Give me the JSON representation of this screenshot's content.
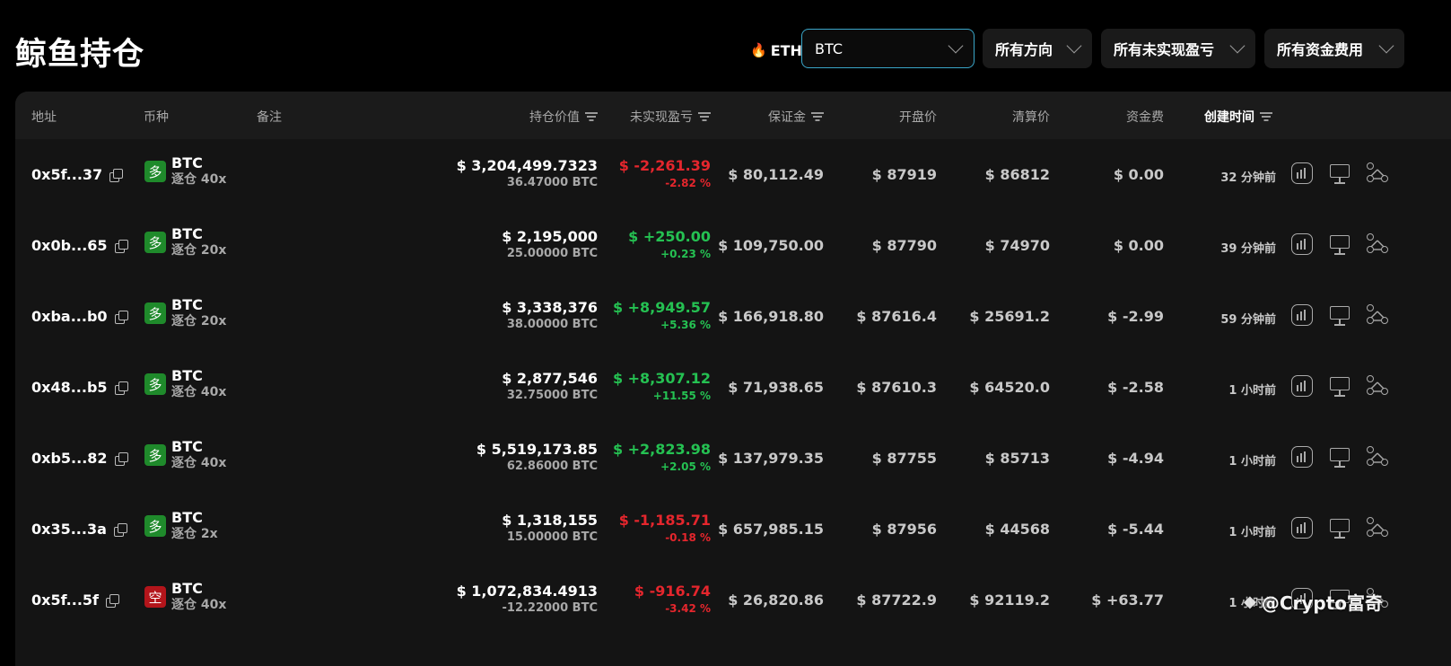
{
  "page": {
    "title": "鲸鱼持仓",
    "hot_coin": "ETH",
    "symbol_select": "BTC",
    "direction_select": "所有方向",
    "pnl_select": "所有未实现盈亏",
    "funding_select": "所有资金费用"
  },
  "table": {
    "headers": {
      "address": "地址",
      "coin": "币种",
      "note": "备注",
      "position_value": "持仓价值",
      "unrealized_pnl": "未实现盈亏",
      "margin": "保证金",
      "open_price": "开盘价",
      "liq_price": "清算价",
      "funding": "资金费",
      "created": "创建时间"
    },
    "rows": [
      {
        "address": "0x5f...37",
        "side": "多",
        "side_type": "long",
        "coin": "BTC",
        "leverage": "逐仓 40x",
        "value": "$ 3,204,499.7323",
        "size": "36.47000 BTC",
        "pnl": "$ -2,261.39",
        "pnl_pct": "-2.82 %",
        "pnl_sign": "neg",
        "margin": "$ 80,112.49",
        "open": "$ 87919",
        "liq": "$ 86812",
        "funding": "$ 0.00",
        "funding_sign": "zero",
        "time": "32 分钟前"
      },
      {
        "address": "0x0b...65",
        "side": "多",
        "side_type": "long",
        "coin": "BTC",
        "leverage": "逐仓 20x",
        "value": "$ 2,195,000",
        "size": "25.00000 BTC",
        "pnl": "$ +250.00",
        "pnl_pct": "+0.23 %",
        "pnl_sign": "pos",
        "margin": "$ 109,750.00",
        "open": "$ 87790",
        "liq": "$ 74970",
        "funding": "$ 0.00",
        "funding_sign": "zero",
        "time": "39 分钟前"
      },
      {
        "address": "0xba...b0",
        "side": "多",
        "side_type": "long",
        "coin": "BTC",
        "leverage": "逐仓 20x",
        "value": "$ 3,338,376",
        "size": "38.00000 BTC",
        "pnl": "$ +8,949.57",
        "pnl_pct": "+5.36 %",
        "pnl_sign": "pos",
        "margin": "$ 166,918.80",
        "open": "$ 87616.4",
        "liq": "$ 25691.2",
        "funding": "$ -2.99",
        "funding_sign": "neg",
        "time": "59 分钟前"
      },
      {
        "address": "0x48...b5",
        "side": "多",
        "side_type": "long",
        "coin": "BTC",
        "leverage": "逐仓 40x",
        "value": "$ 2,877,546",
        "size": "32.75000 BTC",
        "pnl": "$ +8,307.12",
        "pnl_pct": "+11.55 %",
        "pnl_sign": "pos",
        "margin": "$ 71,938.65",
        "open": "$ 87610.3",
        "liq": "$ 64520.0",
        "funding": "$ -2.58",
        "funding_sign": "neg",
        "time": "1 小时前"
      },
      {
        "address": "0xb5...82",
        "side": "多",
        "side_type": "long",
        "coin": "BTC",
        "leverage": "逐仓 40x",
        "value": "$ 5,519,173.85",
        "size": "62.86000 BTC",
        "pnl": "$ +2,823.98",
        "pnl_pct": "+2.05 %",
        "pnl_sign": "pos",
        "margin": "$ 137,979.35",
        "open": "$ 87755",
        "liq": "$ 85713",
        "funding": "$ -4.94",
        "funding_sign": "neg",
        "time": "1 小时前"
      },
      {
        "address": "0x35...3a",
        "side": "多",
        "side_type": "long",
        "coin": "BTC",
        "leverage": "逐仓 2x",
        "value": "$ 1,318,155",
        "size": "15.00000 BTC",
        "pnl": "$ -1,185.71",
        "pnl_pct": "-0.18 %",
        "pnl_sign": "neg",
        "margin": "$ 657,985.15",
        "open": "$ 87956",
        "liq": "$ 44568",
        "funding": "$ -5.44",
        "funding_sign": "neg",
        "time": "1 小时前"
      },
      {
        "address": "0x5f...5f",
        "side": "空",
        "side_type": "short",
        "coin": "BTC",
        "leverage": "逐仓 40x",
        "value": "$ 1,072,834.4913",
        "size": "-12.22000 BTC",
        "pnl": "$ -916.74",
        "pnl_pct": "-3.42 %",
        "pnl_sign": "neg",
        "margin": "$ 26,820.86",
        "open": "$ 87722.9",
        "liq": "$ 92119.2",
        "funding": "$ +63.77",
        "funding_sign": "pos",
        "time": "1 小时前"
      }
    ]
  },
  "watermark": "@Crypto富奇",
  "colors": {
    "positive": "#25c152",
    "negative": "#e5262d",
    "long_badge": "#1f8a2b",
    "short_badge": "#b3151b",
    "accent_border": "#3aa6c9"
  }
}
